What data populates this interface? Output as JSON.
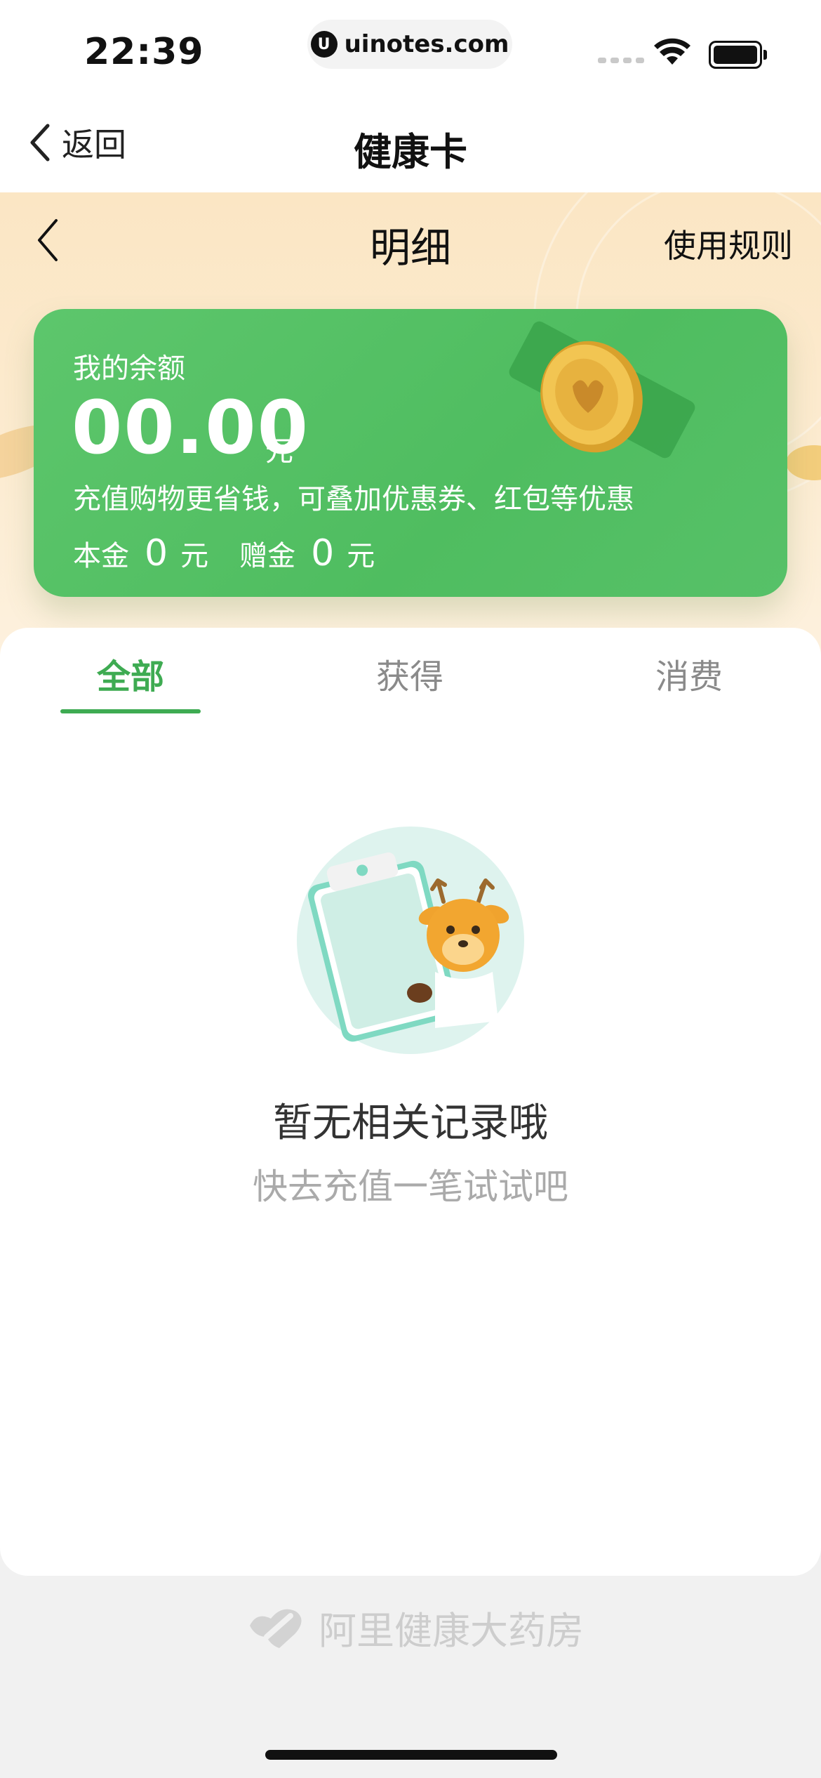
{
  "status": {
    "time": "22:39",
    "url": "uinotes.com"
  },
  "nav": {
    "back_label": "返回",
    "title": "健康卡"
  },
  "header": {
    "title": "明细",
    "rules_label": "使用规则"
  },
  "balance": {
    "label": "我的余额",
    "amount": "00.00",
    "unit": "元",
    "description": "充值购物更省钱，可叠加优惠券、红包等优惠",
    "principal_label": "本金",
    "principal_value": "0",
    "principal_unit": "元",
    "bonus_label": "赠金",
    "bonus_value": "0",
    "bonus_unit": "元"
  },
  "tabs": [
    {
      "label": "全部",
      "active": true
    },
    {
      "label": "获得",
      "active": false
    },
    {
      "label": "消费",
      "active": false
    }
  ],
  "empty": {
    "title": "暂无相关记录哦",
    "subtitle": "快去充值一笔试试吧"
  },
  "footer": {
    "brand": "阿里健康大药房"
  },
  "colors": {
    "accent": "#3eab52",
    "card": "#52be63",
    "hero_bg": "#fbe6c4"
  }
}
